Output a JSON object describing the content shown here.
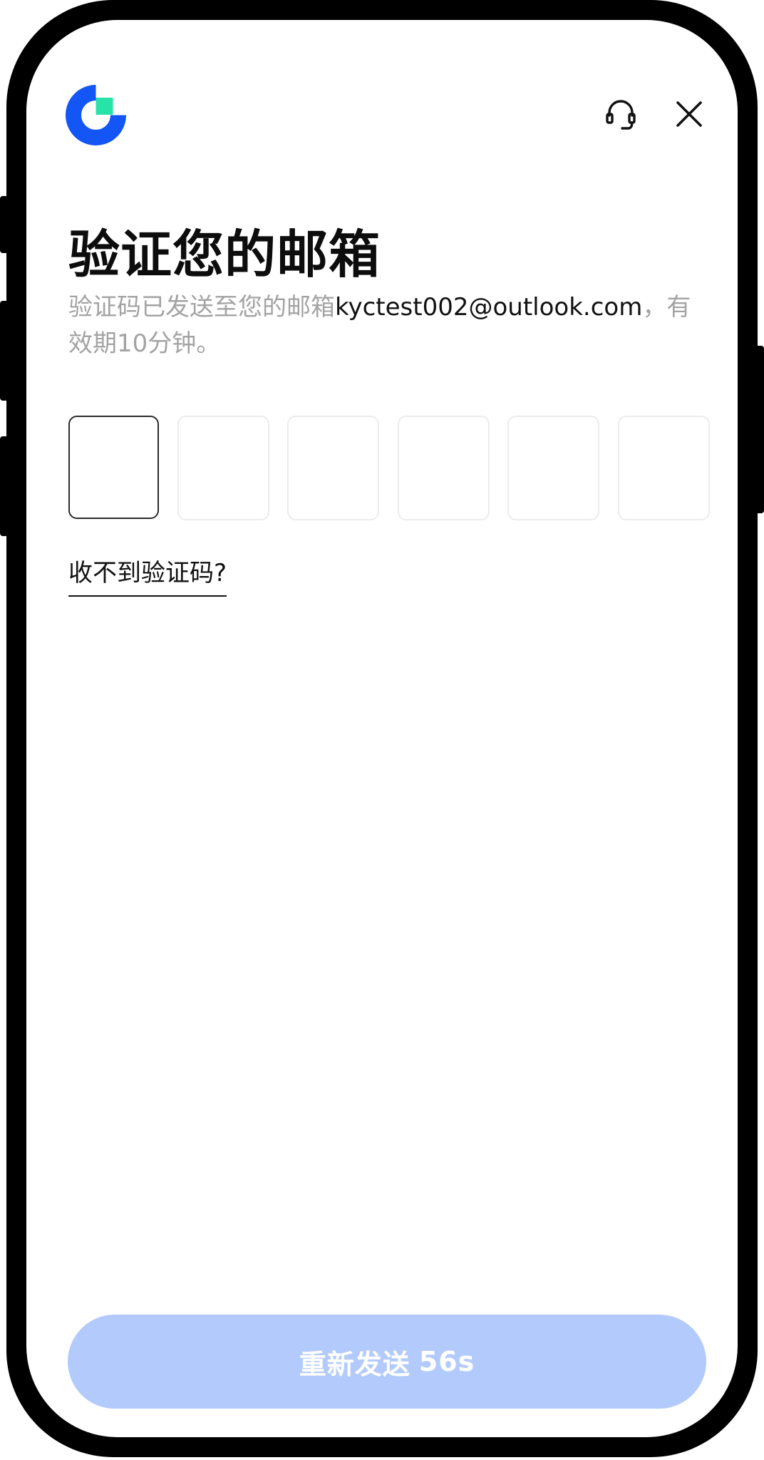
{
  "header": {
    "logo_icon": "app-logo",
    "support_icon": "headset-icon",
    "close_icon": "close-icon"
  },
  "main": {
    "title": "验证您的邮箱",
    "subtitle_prefix": "验证码已发送至您的邮箱",
    "email": "kyctest002@outlook.com",
    "subtitle_suffix": "，有效期10分钟。",
    "code_inputs": [
      "",
      "",
      "",
      "",
      "",
      ""
    ],
    "help_link": "收不到验证码?"
  },
  "footer": {
    "resend_label": "重新发送",
    "countdown": "56s"
  },
  "colors": {
    "logo_blue": "#1356f5",
    "logo_green": "#27e3a8",
    "button_bg_disabled": "#b3cbfc",
    "subtitle_gray": "#a3a3a3"
  }
}
